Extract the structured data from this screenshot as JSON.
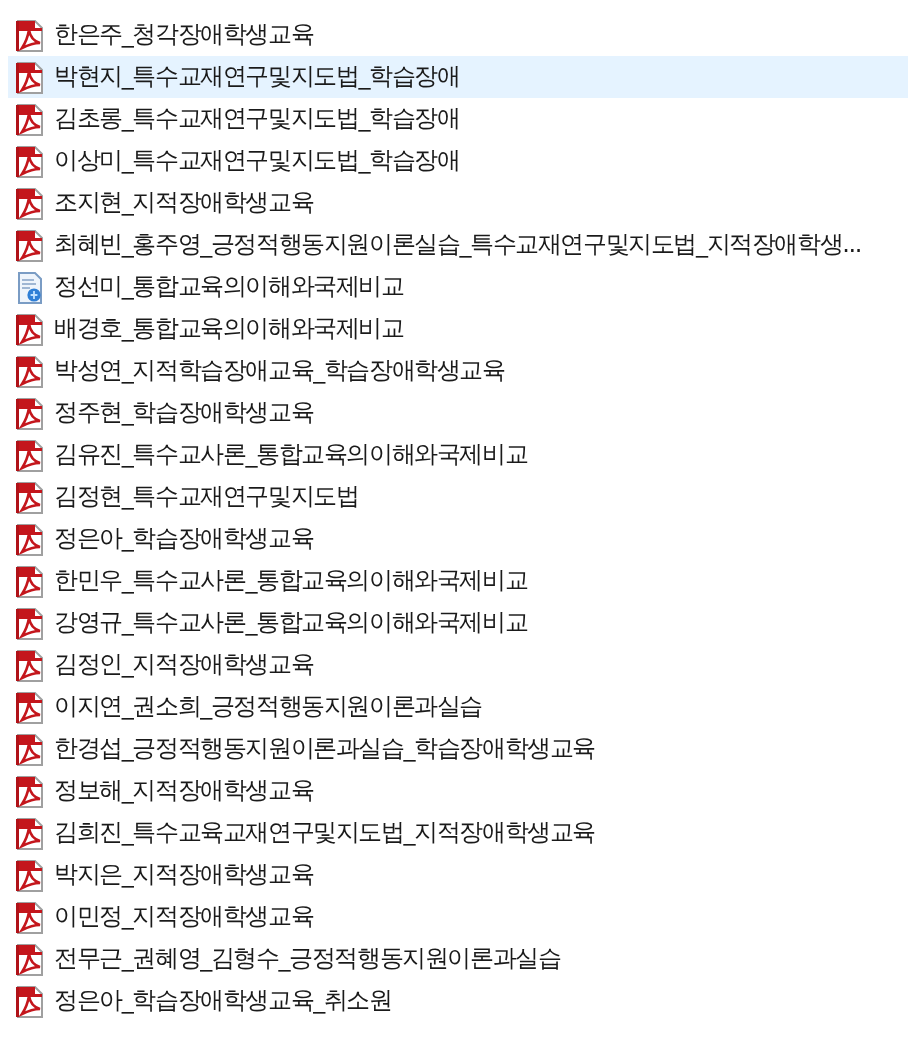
{
  "files": [
    {
      "name": "한은주_청각장애학생교육",
      "kind": "pdf",
      "selected": false
    },
    {
      "name": "박현지_특수교재연구및지도법_학습장애",
      "kind": "pdf",
      "selected": true
    },
    {
      "name": "김초롱_특수교재연구및지도법_학습장애",
      "kind": "pdf",
      "selected": false
    },
    {
      "name": "이상미_특수교재연구및지도법_학습장애",
      "kind": "pdf",
      "selected": false
    },
    {
      "name": "조지현_지적장애학생교육",
      "kind": "pdf",
      "selected": false
    },
    {
      "name": "최혜빈_홍주영_긍정적행동지원이론실습_특수교재연구및지도법_지적장애학생...",
      "kind": "pdf",
      "selected": false
    },
    {
      "name": "정선미_통합교육의이해와국제비교",
      "kind": "web",
      "selected": false
    },
    {
      "name": "배경호_통합교육의이해와국제비교",
      "kind": "pdf",
      "selected": false
    },
    {
      "name": "박성연_지적학습장애교육_학습장애학생교육",
      "kind": "pdf",
      "selected": false
    },
    {
      "name": "정주현_학습장애학생교육",
      "kind": "pdf",
      "selected": false
    },
    {
      "name": "김유진_특수교사론_통합교육의이해와국제비교",
      "kind": "pdf",
      "selected": false
    },
    {
      "name": "김정현_특수교재연구및지도법",
      "kind": "pdf",
      "selected": false
    },
    {
      "name": "정은아_학습장애학생교육",
      "kind": "pdf",
      "selected": false
    },
    {
      "name": "한민우_특수교사론_통합교육의이해와국제비교",
      "kind": "pdf",
      "selected": false
    },
    {
      "name": "강영규_특수교사론_통합교육의이해와국제비교",
      "kind": "pdf",
      "selected": false
    },
    {
      "name": "김정인_지적장애학생교육",
      "kind": "pdf",
      "selected": false
    },
    {
      "name": "이지연_권소희_긍정적행동지원이론과실습",
      "kind": "pdf",
      "selected": false
    },
    {
      "name": "한경섭_긍정적행동지원이론과실습_학습장애학생교육",
      "kind": "pdf",
      "selected": false
    },
    {
      "name": "정보해_지적장애학생교육",
      "kind": "pdf",
      "selected": false
    },
    {
      "name": "김희진_특수교육교재연구및지도법_지적장애학생교육",
      "kind": "pdf",
      "selected": false
    },
    {
      "name": "박지은_지적장애학생교육",
      "kind": "pdf",
      "selected": false
    },
    {
      "name": "이민정_지적장애학생교육",
      "kind": "pdf",
      "selected": false
    },
    {
      "name": "전무근_권혜영_김형수_긍정적행동지원이론과실습",
      "kind": "pdf",
      "selected": false
    },
    {
      "name": "정은아_학습장애학생교육_취소원",
      "kind": "pdf",
      "selected": false
    }
  ]
}
